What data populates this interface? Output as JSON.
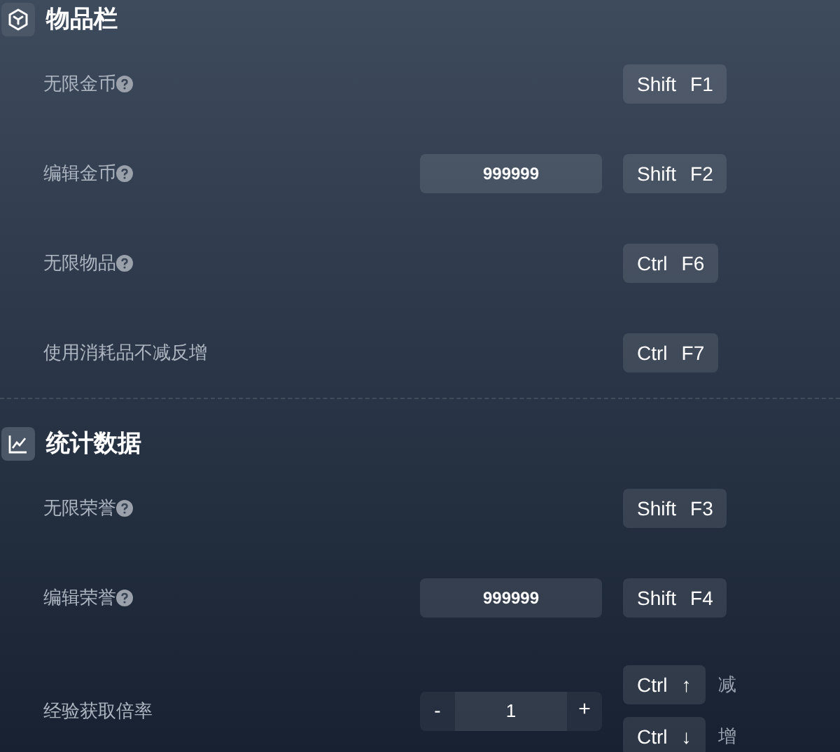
{
  "sections": [
    {
      "kind": "inventory",
      "title": "物品栏",
      "rows": [
        {
          "kind": "toggle",
          "label": "无限金币",
          "help": true,
          "hotkeys": [
            {
              "keys": [
                "Shift",
                "F1"
              ]
            }
          ]
        },
        {
          "kind": "input",
          "label": "编辑金币",
          "help": true,
          "value": "999999",
          "hotkeys": [
            {
              "keys": [
                "Shift",
                "F2"
              ]
            }
          ]
        },
        {
          "kind": "toggle",
          "label": "无限物品",
          "help": true,
          "hotkeys": [
            {
              "keys": [
                "Ctrl",
                "F6"
              ]
            }
          ]
        },
        {
          "kind": "toggle",
          "label": "使用消耗品不减反增",
          "help": false,
          "hotkeys": [
            {
              "keys": [
                "Ctrl",
                "F7"
              ]
            }
          ]
        }
      ]
    },
    {
      "kind": "stats",
      "title": "统计数据",
      "rows": [
        {
          "kind": "toggle",
          "label": "无限荣誉",
          "help": true,
          "hotkeys": [
            {
              "keys": [
                "Shift",
                "F3"
              ]
            }
          ]
        },
        {
          "kind": "input",
          "label": "编辑荣誉",
          "help": true,
          "value": "999999",
          "hotkeys": [
            {
              "keys": [
                "Shift",
                "F4"
              ]
            }
          ]
        },
        {
          "kind": "stepper",
          "label": "经验获取倍率",
          "help": false,
          "minus": "-",
          "value": "1",
          "plus": "+",
          "hotkeys": [
            {
              "keys": [
                "Ctrl",
                "↑"
              ],
              "action": "减"
            },
            {
              "keys": [
                "Ctrl",
                "↓"
              ],
              "action": "增"
            }
          ]
        }
      ]
    }
  ]
}
